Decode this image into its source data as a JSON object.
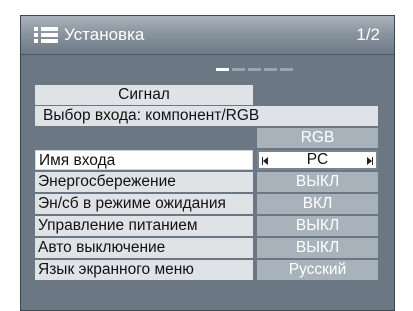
{
  "header": {
    "title": "Установка",
    "page": "1/2",
    "icon": "menu-list-icon"
  },
  "pager": {
    "count": 5,
    "active_index": 0
  },
  "section": {
    "title": "Сигнал",
    "input_select_label": "Выбор входа: компонент/RGB",
    "input_select_value": "RGB"
  },
  "settings": [
    {
      "label": "Имя входа",
      "value": "PC",
      "selected": true
    },
    {
      "label": "Энергосбережение",
      "value": "ВЫКЛ"
    },
    {
      "label": "Эн/сб в режиме ожидания",
      "value": "ВКЛ"
    },
    {
      "label": "Управление питанием",
      "value": "ВЫКЛ"
    },
    {
      "label": "Авто выключение",
      "value": "ВЫКЛ"
    },
    {
      "label": "Язык экранного меню",
      "value": "Русский"
    }
  ],
  "colors": {
    "panel": "#6b7883",
    "label_bg": "#dfe3e6",
    "value_bg": "#a7b2bb",
    "selected_bg": "#ffffff"
  }
}
